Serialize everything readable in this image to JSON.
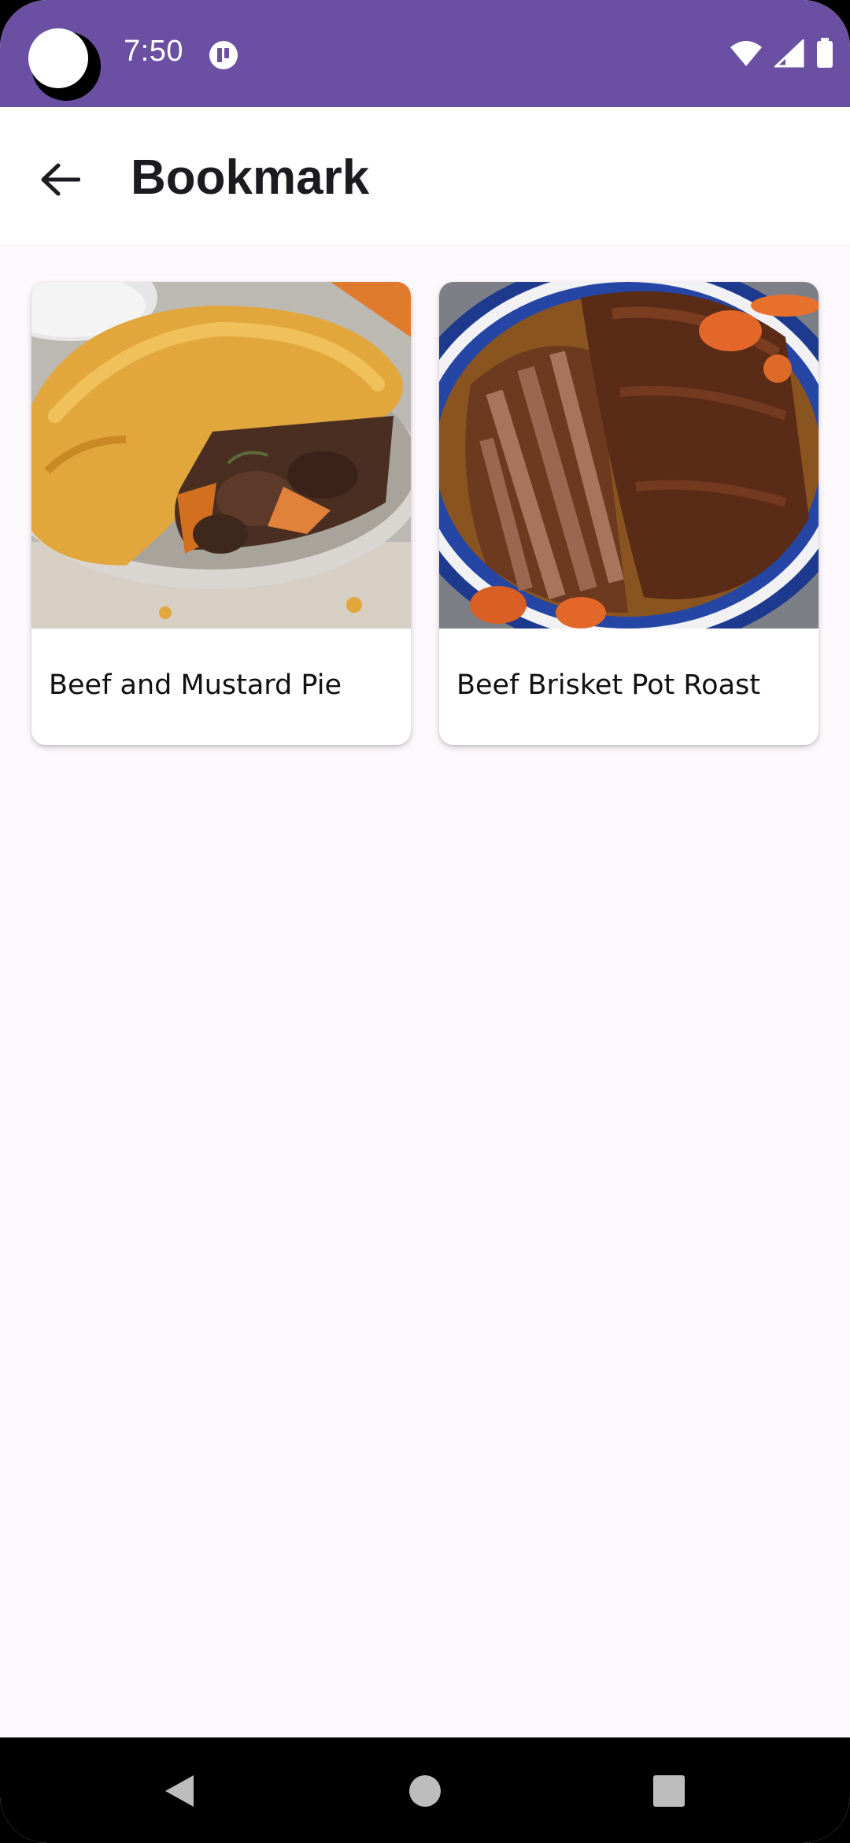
{
  "status_bar": {
    "time": "7:50",
    "notification_icon": "pause-circle-icon",
    "wifi_icon": "wifi-icon",
    "signal_icon": "cell-signal-icon",
    "battery_icon": "battery-icon",
    "color": "#6a4fa3"
  },
  "app_bar": {
    "back_icon": "arrow-back-icon",
    "title": "Bookmark"
  },
  "bookmarks": [
    {
      "title": "Beef and Mustard Pie",
      "image": "beef-mustard-pie-photo"
    },
    {
      "title": "Beef Brisket Pot Roast",
      "image": "beef-brisket-pot-roast-photo"
    }
  ],
  "nav_bar": {
    "back": "nav-back-icon",
    "home": "nav-home-icon",
    "recents": "nav-recents-icon"
  }
}
